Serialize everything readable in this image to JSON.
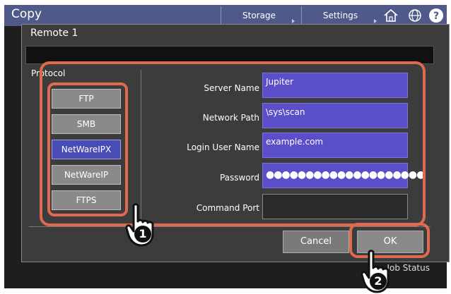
{
  "topbar": {
    "title": "Copy",
    "tabs": [
      {
        "label": "Storage"
      },
      {
        "label": "Settings"
      }
    ],
    "icons": [
      "home-icon",
      "globe-icon",
      "help-icon"
    ]
  },
  "background": {
    "page_number": "1",
    "job_status_label": "Job Status"
  },
  "dialog": {
    "title": "Remote 1",
    "protocol_label": "Protocol",
    "protocols": [
      {
        "label": "FTP",
        "selected": false
      },
      {
        "label": "SMB",
        "selected": false
      },
      {
        "label": "NetWareIPX",
        "selected": true
      },
      {
        "label": "NetWareIP",
        "selected": false
      },
      {
        "label": "FTPS",
        "selected": false
      }
    ],
    "fields": {
      "server_name": {
        "label": "Server Name",
        "value": "Jupiter"
      },
      "network_path": {
        "label": "Network Path",
        "value": "\\sys\\scan"
      },
      "login_user_name": {
        "label": "Login User Name",
        "value": "example.com"
      },
      "password": {
        "label": "Password",
        "value": "●●●●●●●●●●●●●●●●●●●●"
      },
      "command_port": {
        "label": "Command Port",
        "value": ""
      }
    },
    "cancel_label": "Cancel",
    "ok_label": "OK"
  },
  "callouts": [
    {
      "number": "1"
    },
    {
      "number": "2"
    }
  ],
  "colors": {
    "highlight": "#e06a50",
    "selected_button": "#4a4cb5",
    "input_fill": "#5a4fc8",
    "topbar": "#505a8a"
  }
}
